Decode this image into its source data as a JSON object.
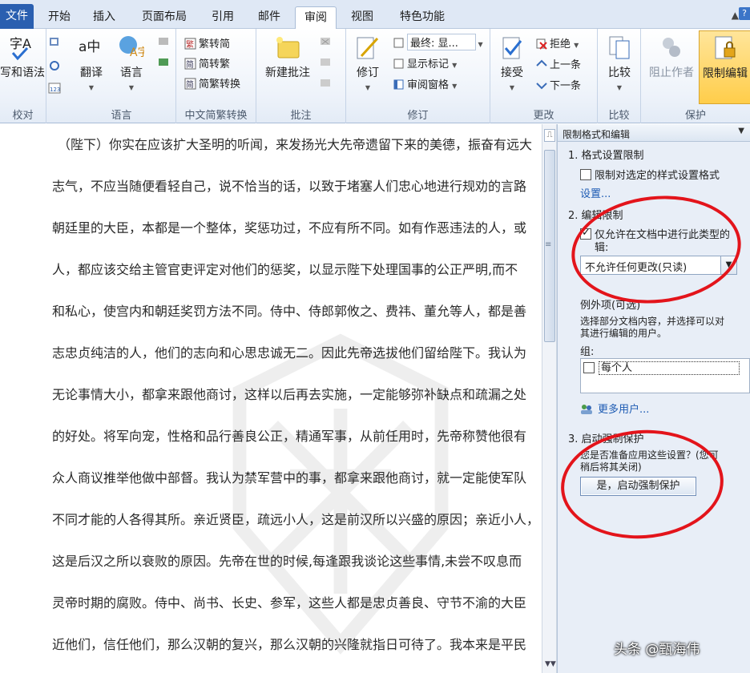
{
  "tabs": {
    "file": "文件",
    "home": "开始",
    "insert": "插入",
    "layout": "页面布局",
    "references": "引用",
    "mailings": "邮件",
    "review": "审阅",
    "view": "视图",
    "special": "特色功能"
  },
  "ribbon": {
    "proofing": {
      "label": "校对",
      "spell_label": "写和语法",
      "icon_text": "字A"
    },
    "language": {
      "label": "语言",
      "translate": "翻译",
      "language": "语言",
      "translate_icon_text": "a中",
      "language_icon_text": "A字"
    },
    "chinese_conversion": {
      "label": "中文简繁转换",
      "to_traditional": "繁转简",
      "to_simplified": "简转繁",
      "convert": "简繁转换"
    },
    "comments": {
      "label": "批注",
      "new_comment": "新建批注"
    },
    "tracking": {
      "label": "修订",
      "track_changes": "修订",
      "final_dropdown": "最终: 显...",
      "show_markup": "显示标记",
      "review_pane": "审阅窗格"
    },
    "changes": {
      "label": "更改",
      "accept": "接受",
      "reject": "拒绝",
      "previous": "上一条",
      "next": "下一条"
    },
    "compare": {
      "label": "比较",
      "compare": "比较"
    },
    "protect": {
      "label": "保护",
      "block_authors": "阻止作者",
      "restrict_editing": "限制编辑"
    }
  },
  "document": {
    "lines": [
      "（陛下）你实在应该扩大圣明的听闻，来发扬光大先帝遗留下来的美德，振奋有远大",
      "志气，不应当随便看轻自己，说不恰当的话，以致于堵塞人们忠心地进行规劝的言路",
      "朝廷里的大臣，本都是一个整体，奖惩功过，不应有所不同。如有作恶违法的人，或",
      "人，都应该交给主管官吏评定对他们的惩奖，以显示陛下处理国事的公正严明,而不",
      "和私心，使宫内和朝廷奖罚方法不同。侍中、侍郎郭攸之、费祎、董允等人，都是善",
      "志忠贞纯洁的人，他们的志向和心思忠诚无二。因此先帝选拔他们留给陛下。我认为",
      "无论事情大小，都拿来跟他商讨，这样以后再去实施，一定能够弥补缺点和疏漏之处",
      "的好处。将军向宠，性格和品行善良公正，精通军事，从前任用时，先帝称赞他很有",
      "众人商议推举他做中部督。我认为禁军营中的事，都拿来跟他商讨，就一定能使军队",
      "不同才能的人各得其所。亲近贤臣，疏远小人，这是前汉所以兴盛的原因；亲近小人，",
      "这是后汉之所以衰败的原因。先帝在世的时候,每逢跟我谈论这些事情,未尝不叹息而",
      "灵帝时期的腐败。侍中、尚书、长史、参军，这些人都是忠贞善良、守节不渝的大臣",
      "近他们，信任他们，那么汉朝的复兴，那么汉朝的兴隆就指日可待了。我本来是平民"
    ]
  },
  "pane": {
    "title": "限制格式和编辑",
    "section1_title": "1. 格式设置限制",
    "section1_checkbox": "限制对选定的样式设置格式",
    "section1_link": "设置...",
    "section2_title": "2. 编辑限制",
    "section2_checkbox_line1": "仅允许在文档中进行此类型的",
    "section2_checkbox_line2": "辑:",
    "section2_dropdown_value": "不允许任何更改(只读)",
    "exceptions_title": "例外项(可选)",
    "exceptions_desc_line1": "选择部分文档内容，并选择可以对",
    "exceptions_desc_line2": "其进行编辑的用户。",
    "groups_label": "组:",
    "group_everyone": "每个人",
    "more_users": "更多用户...",
    "section3_title": "3. 启动强制保护",
    "section3_desc_line1": "您是否准备应用这些设置？(您可",
    "section3_desc_line2": "稍后将其关闭)",
    "start_button": "是，启动强制保护"
  },
  "credit": "头条 @甄海伟",
  "colors": {
    "file_tab": "#2a5fb0",
    "annotation_red": "#e3141b",
    "link": "#1d5bb3"
  }
}
